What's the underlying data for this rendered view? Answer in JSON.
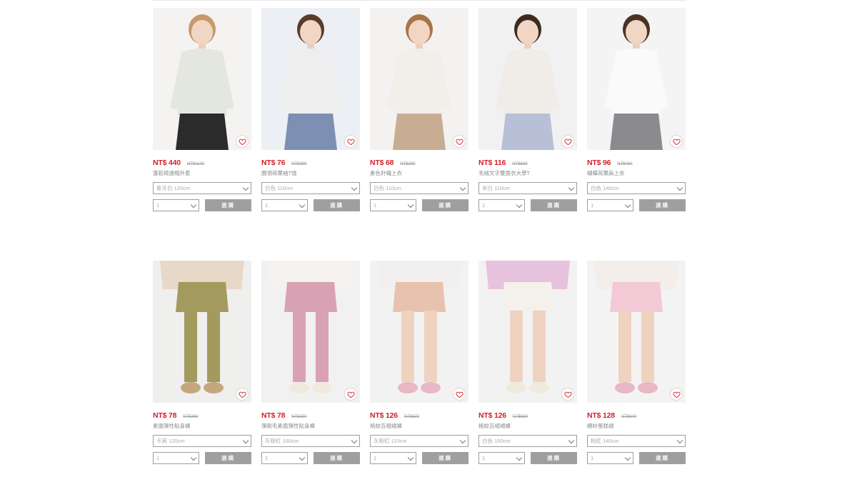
{
  "heart_color": "#d61e27",
  "price_color": "#d61e27",
  "buy_button_color": "#9f9f9f",
  "products": [
    {
      "price": "NT$ 440",
      "orig": "NT$1100",
      "name": "蓬鬆棉連帽外套",
      "color": "象牙白 120cm",
      "qty": "1",
      "buy": "選購",
      "bg": "#f4f3f1",
      "top": "#e4e6e0",
      "bottom": "#2b2b2b",
      "hair": "#c79a6a"
    },
    {
      "price": "NT$ 76",
      "orig": "NT$390",
      "name": "圓領荷葉袖T恤",
      "color": "白色 110cm",
      "qty": "1",
      "buy": "選購",
      "bg": "#eceff3",
      "top": "#eeeeee",
      "bottom": "#7d8fb3",
      "hair": "#5a3a28"
    },
    {
      "price": "NT$ 68",
      "orig": "NT$290",
      "name": "素色針織上衣",
      "color": "白色 110cm",
      "qty": "1",
      "buy": "選購",
      "bg": "#f3f2f0",
      "top": "#f2efea",
      "bottom": "#c8ad93",
      "hair": "#a87448"
    },
    {
      "price": "NT$ 116",
      "orig": "NT$580",
      "name": "毛絨文字雙面衣大學T",
      "color": "米白 110cm",
      "qty": "1",
      "buy": "選購",
      "bg": "#f1f1f2",
      "top": "#f0ede8",
      "bottom": "#b8c0d8",
      "hair": "#3d2a20"
    },
    {
      "price": "NT$ 96",
      "orig": "NT$480",
      "name": "蝴蝶荷葉肩上衣",
      "color": "白色 140cm",
      "qty": "1",
      "buy": "選購",
      "bg": "#f4f4f4",
      "top": "#fafafa",
      "bottom": "#8a8a8f",
      "hair": "#4a3226"
    },
    {
      "price": "NT$ 78",
      "orig": "NT$390",
      "name": "素面彈性貼身褲",
      "color": "卡其 120cm",
      "qty": "1",
      "buy": "選購",
      "bg": "#efefee",
      "top": "#e8d8c8",
      "bottom": "#a39a5e",
      "hair": "#000000"
    },
    {
      "price": "NT$ 78",
      "orig": "NT$390",
      "name": "彈刷毛素面彈性貼身褲",
      "color": "灰粉紅 160cm",
      "qty": "1",
      "buy": "選購",
      "bg": "#f2f1f1",
      "top": "#f5f2ef",
      "bottom": "#d9a1b4",
      "hair": "#000000"
    },
    {
      "price": "NT$ 126",
      "orig": "NT$630",
      "name": "格紋百褶裙褲",
      "color": "灰粉紅 110cm",
      "qty": "1",
      "buy": "選購",
      "bg": "#f3f2f2",
      "top": "#f2f0ee",
      "bottom": "#e8c2ae",
      "hair": "#000000"
    },
    {
      "price": "NT$ 126",
      "orig": "NT$630",
      "name": "格紋百褶裙褲",
      "color": "白色 150cm",
      "qty": "1",
      "buy": "選購",
      "bg": "#f2f2f2",
      "top": "#e7c2dc",
      "bottom": "#f4f1ea",
      "hair": "#000000"
    },
    {
      "price": "NT$ 128",
      "orig": "NT$640",
      "name": "網紗蛋糕裙",
      "color": "粉紅 140cm",
      "qty": "1",
      "buy": "選購",
      "bg": "#f4f3f3",
      "top": "#f3eee9",
      "bottom": "#f3c9d6",
      "hair": "#000000"
    }
  ]
}
